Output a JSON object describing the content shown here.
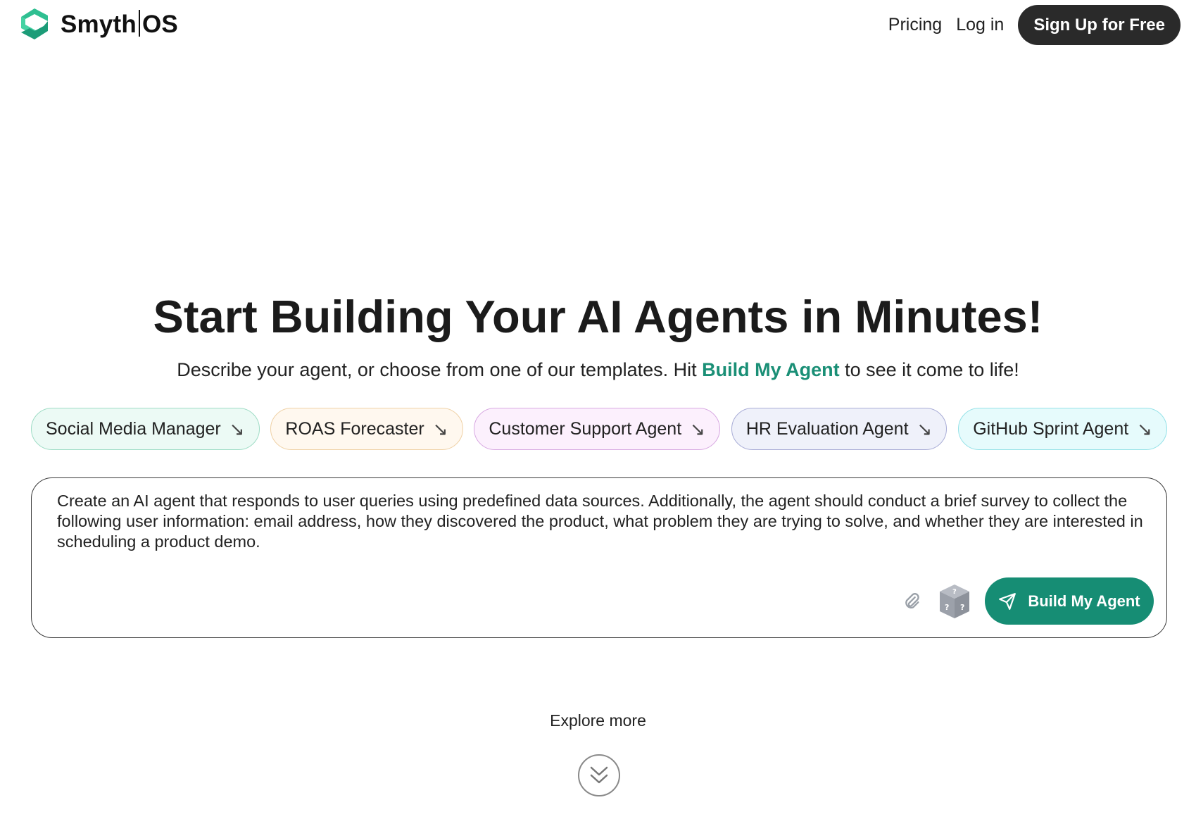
{
  "header": {
    "brand": "Smyth|OS",
    "brand_left": "Smyth",
    "brand_right": "OS",
    "nav": {
      "pricing": "Pricing",
      "login": "Log in",
      "signup": "Sign Up for Free"
    }
  },
  "hero": {
    "title": "Start Building Your AI Agents in Minutes!",
    "subtitle_before": "Describe your agent, or choose from one of our templates. Hit ",
    "subtitle_highlight": "Build My Agent",
    "subtitle_after": " to see it come to life!"
  },
  "templates": [
    {
      "label": "Social Media Manager",
      "bg": "#ecfaf5",
      "border": "#9edcc5"
    },
    {
      "label": "ROAS Forecaster",
      "bg": "#fff8ef",
      "border": "#efd1a6"
    },
    {
      "label": "Customer Support Agent",
      "bg": "#fcf0fd",
      "border": "#d8a9e2"
    },
    {
      "label": "HR Evaluation Agent",
      "bg": "#eff1fa",
      "border": "#a8acd6"
    },
    {
      "label": "GitHub Sprint Agent",
      "bg": "#e6fbfc",
      "border": "#96e2e8"
    }
  ],
  "template_arrow_icon": "arrow-down-right-icon",
  "prompt": {
    "value": "Create an AI agent that responds to user queries using predefined data sources. Additionally, the agent should conduct a brief survey to collect the following user information: email address, how they discovered the product, what problem they are trying to solve, and whether they are interested in scheduling a product demo.",
    "build_label": "Build My Agent"
  },
  "explore": {
    "label": "Explore more"
  },
  "colors": {
    "accent": "#168d74",
    "dark": "#2a2a2a"
  }
}
